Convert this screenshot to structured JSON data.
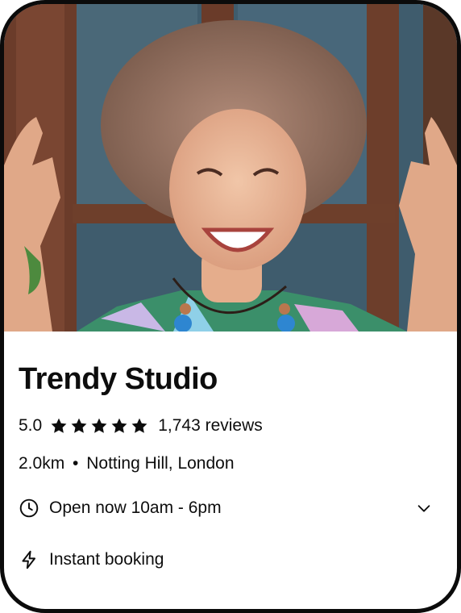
{
  "listing": {
    "photo_alt": "smiling-woman-photo",
    "name": "Trendy Studio",
    "rating": "5.0",
    "stars": 5,
    "reviews": "1,743 reviews",
    "distance": "2.0km",
    "separator": "•",
    "location": "Notting Hill, London",
    "hours": "Open now 10am - 6pm",
    "booking": "Instant booking"
  },
  "icons": {
    "star": "star-icon",
    "clock": "clock-icon",
    "chevron": "chevron-down-icon",
    "bolt": "lightning-bolt-icon"
  },
  "colors": {
    "text": "#0d0d0d",
    "frame": "#0b0b0b",
    "background": "#ffffff"
  }
}
